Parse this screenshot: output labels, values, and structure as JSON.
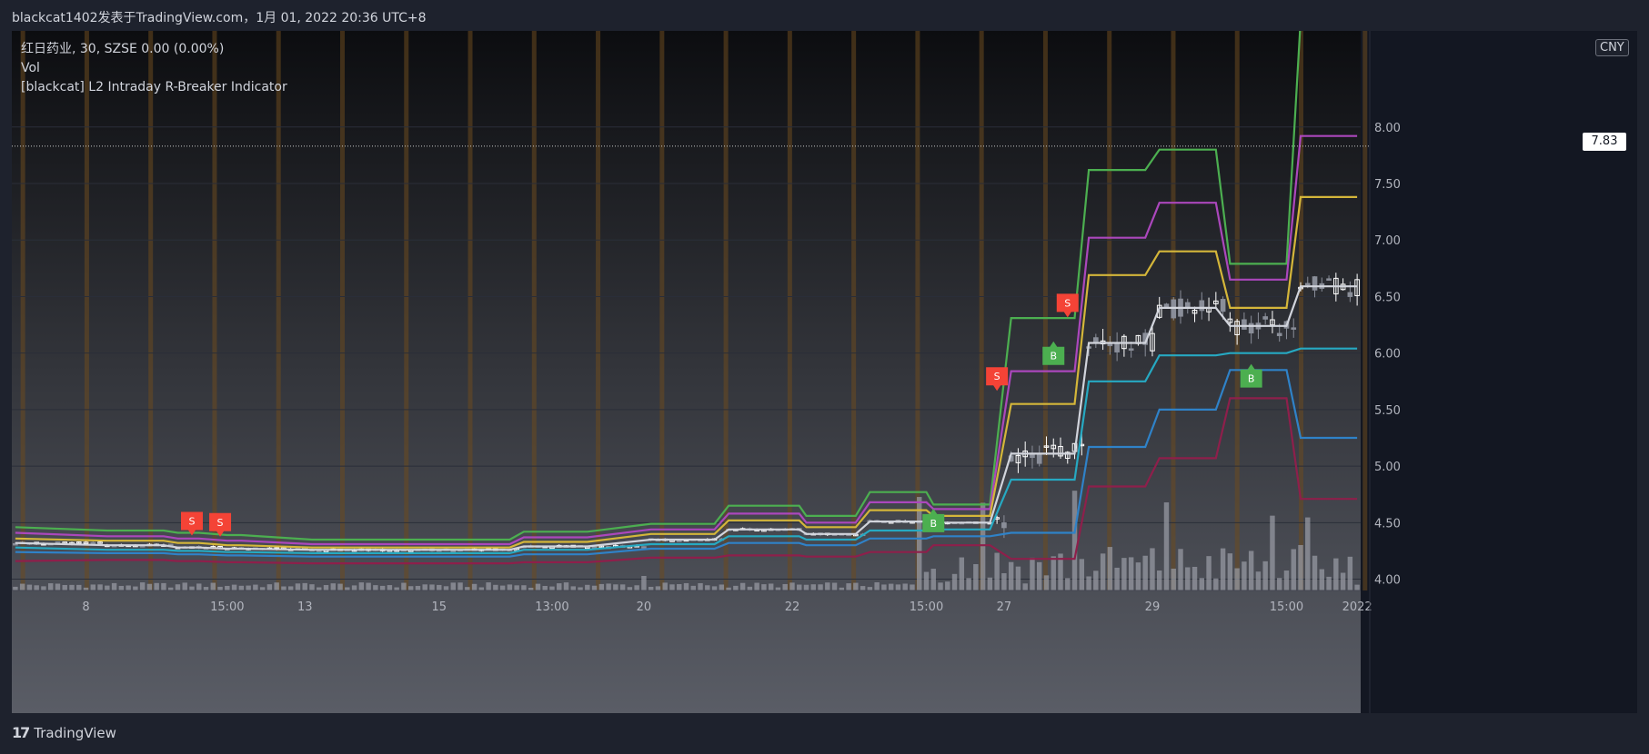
{
  "header": {
    "caption": "blackcat1402发表于TradingView.com，1月 01, 2022 20:36 UTC+8"
  },
  "legend": {
    "symbol": "红日药业, 30, SZSE  0.00 (0.00%)",
    "volume": "Vol",
    "indicator": "[blackcat] L2 Intraday R-Breaker Indicator"
  },
  "price_scale": {
    "currency": "CNY",
    "last_price": "7.83"
  },
  "footer": {
    "brand": "TradingView"
  },
  "colors": {
    "background": "#131722",
    "candle": "#ffffff",
    "candle_down": "#8a8e99",
    "volume": "#9598a1",
    "grid": "#2a2e39",
    "vline": "#6b4a1f",
    "buy_marker": "#4caf50",
    "sell_marker": "#f44336"
  },
  "chart_data": {
    "type": "line",
    "title": "",
    "xlabel": "",
    "ylabel": "",
    "ylim": [
      3.9,
      8.85
    ],
    "y_ticks": [
      "4.00",
      "4.50",
      "5.00",
      "5.50",
      "6.00",
      "6.50",
      "7.00",
      "7.50",
      "8.00"
    ],
    "x_tick_labels": [
      {
        "label": "8",
        "i": 10
      },
      {
        "label": "15:00",
        "i": 30
      },
      {
        "label": "13",
        "i": 41
      },
      {
        "label": "15",
        "i": 60
      },
      {
        "label": "13:00",
        "i": 76
      },
      {
        "label": "20",
        "i": 89
      },
      {
        "label": "22",
        "i": 110
      },
      {
        "label": "15:00",
        "i": 129
      },
      {
        "label": "27",
        "i": 140
      },
      {
        "label": "29",
        "i": 161
      },
      {
        "label": "15:00",
        "i": 180
      },
      {
        "label": "2022",
        "i": 190
      }
    ],
    "n_bars": 191,
    "series": [
      {
        "color": "#4caf50",
        "steps": [
          [
            0,
            4.46
          ],
          [
            13,
            4.43
          ],
          [
            21,
            4.43
          ],
          [
            23,
            4.41
          ],
          [
            26,
            4.41
          ],
          [
            30,
            4.39
          ],
          [
            32,
            4.39
          ],
          [
            42,
            4.35
          ],
          [
            70,
            4.35
          ],
          [
            72,
            4.42
          ],
          [
            81,
            4.42
          ],
          [
            90,
            4.49
          ],
          [
            99,
            4.49
          ],
          [
            101,
            4.65
          ],
          [
            111,
            4.65
          ],
          [
            112,
            4.56
          ],
          [
            119,
            4.56
          ],
          [
            121,
            4.77
          ],
          [
            129,
            4.77
          ],
          [
            130,
            4.66
          ],
          [
            138,
            4.66
          ],
          [
            141,
            6.31
          ],
          [
            150,
            6.31
          ],
          [
            152,
            7.62
          ],
          [
            160,
            7.62
          ],
          [
            162,
            7.8
          ],
          [
            170,
            7.8
          ],
          [
            172,
            6.79
          ],
          [
            180,
            6.79
          ],
          [
            182,
            8.95
          ]
        ]
      },
      {
        "color": "#ab47bc",
        "steps": [
          [
            0,
            4.41
          ],
          [
            13,
            4.38
          ],
          [
            21,
            4.38
          ],
          [
            23,
            4.36
          ],
          [
            26,
            4.36
          ],
          [
            30,
            4.34
          ],
          [
            32,
            4.34
          ],
          [
            42,
            4.31
          ],
          [
            70,
            4.31
          ],
          [
            72,
            4.37
          ],
          [
            81,
            4.37
          ],
          [
            90,
            4.44
          ],
          [
            99,
            4.44
          ],
          [
            101,
            4.58
          ],
          [
            111,
            4.58
          ],
          [
            112,
            4.5
          ],
          [
            119,
            4.5
          ],
          [
            121,
            4.68
          ],
          [
            129,
            4.68
          ],
          [
            130,
            4.62
          ],
          [
            138,
            4.62
          ],
          [
            141,
            5.84
          ],
          [
            150,
            5.84
          ],
          [
            152,
            7.02
          ],
          [
            160,
            7.02
          ],
          [
            162,
            7.33
          ],
          [
            170,
            7.33
          ],
          [
            172,
            6.65
          ],
          [
            180,
            6.65
          ],
          [
            182,
            7.92
          ]
        ]
      },
      {
        "color": "#d4b63a",
        "steps": [
          [
            0,
            4.36
          ],
          [
            13,
            4.34
          ],
          [
            21,
            4.34
          ],
          [
            23,
            4.32
          ],
          [
            26,
            4.32
          ],
          [
            30,
            4.3
          ],
          [
            32,
            4.3
          ],
          [
            42,
            4.28
          ],
          [
            70,
            4.28
          ],
          [
            72,
            4.33
          ],
          [
            81,
            4.33
          ],
          [
            90,
            4.4
          ],
          [
            99,
            4.4
          ],
          [
            101,
            4.52
          ],
          [
            111,
            4.52
          ],
          [
            112,
            4.46
          ],
          [
            119,
            4.46
          ],
          [
            121,
            4.61
          ],
          [
            129,
            4.61
          ],
          [
            130,
            4.56
          ],
          [
            138,
            4.56
          ],
          [
            141,
            5.55
          ],
          [
            150,
            5.55
          ],
          [
            152,
            6.69
          ],
          [
            160,
            6.69
          ],
          [
            162,
            6.9
          ],
          [
            170,
            6.9
          ],
          [
            172,
            6.4
          ],
          [
            180,
            6.4
          ],
          [
            182,
            7.38
          ]
        ]
      },
      {
        "color": "#d1d4dc",
        "steps": [
          [
            0,
            4.32
          ],
          [
            13,
            4.3
          ],
          [
            21,
            4.3
          ],
          [
            23,
            4.28
          ],
          [
            26,
            4.28
          ],
          [
            30,
            4.27
          ],
          [
            32,
            4.27
          ],
          [
            42,
            4.26
          ],
          [
            70,
            4.26
          ],
          [
            72,
            4.29
          ],
          [
            81,
            4.29
          ],
          [
            90,
            4.35
          ],
          [
            99,
            4.35
          ],
          [
            101,
            4.44
          ],
          [
            111,
            4.44
          ],
          [
            112,
            4.4
          ],
          [
            119,
            4.4
          ],
          [
            121,
            4.51
          ],
          [
            129,
            4.51
          ],
          [
            130,
            4.5
          ],
          [
            138,
            4.5
          ],
          [
            141,
            5.11
          ],
          [
            150,
            5.11
          ],
          [
            152,
            6.09
          ],
          [
            160,
            6.09
          ],
          [
            162,
            6.4
          ],
          [
            170,
            6.4
          ],
          [
            172,
            6.24
          ],
          [
            180,
            6.24
          ],
          [
            182,
            6.59
          ]
        ]
      },
      {
        "color": "#26a9c2",
        "steps": [
          [
            0,
            4.28
          ],
          [
            13,
            4.26
          ],
          [
            21,
            4.26
          ],
          [
            23,
            4.25
          ],
          [
            26,
            4.25
          ],
          [
            30,
            4.24
          ],
          [
            32,
            4.24
          ],
          [
            42,
            4.23
          ],
          [
            70,
            4.23
          ],
          [
            72,
            4.26
          ],
          [
            81,
            4.26
          ],
          [
            90,
            4.31
          ],
          [
            99,
            4.31
          ],
          [
            101,
            4.38
          ],
          [
            111,
            4.38
          ],
          [
            112,
            4.35
          ],
          [
            119,
            4.35
          ],
          [
            121,
            4.43
          ],
          [
            129,
            4.43
          ],
          [
            130,
            4.44
          ],
          [
            138,
            4.44
          ],
          [
            141,
            4.88
          ],
          [
            150,
            4.88
          ],
          [
            152,
            5.75
          ],
          [
            160,
            5.75
          ],
          [
            162,
            5.98
          ],
          [
            170,
            5.98
          ],
          [
            172,
            6.0
          ],
          [
            180,
            6.0
          ],
          [
            182,
            6.04
          ]
        ]
      },
      {
        "color": "#2f82c8",
        "steps": [
          [
            0,
            4.24
          ],
          [
            13,
            4.23
          ],
          [
            21,
            4.23
          ],
          [
            23,
            4.22
          ],
          [
            26,
            4.22
          ],
          [
            30,
            4.21
          ],
          [
            32,
            4.21
          ],
          [
            42,
            4.2
          ],
          [
            70,
            4.2
          ],
          [
            72,
            4.22
          ],
          [
            81,
            4.22
          ],
          [
            90,
            4.27
          ],
          [
            99,
            4.27
          ],
          [
            101,
            4.32
          ],
          [
            111,
            4.32
          ],
          [
            112,
            4.3
          ],
          [
            119,
            4.3
          ],
          [
            121,
            4.36
          ],
          [
            129,
            4.36
          ],
          [
            130,
            4.38
          ],
          [
            138,
            4.38
          ],
          [
            141,
            4.41
          ],
          [
            150,
            4.41
          ],
          [
            152,
            5.17
          ],
          [
            160,
            5.17
          ],
          [
            162,
            5.5
          ],
          [
            170,
            5.5
          ],
          [
            172,
            5.85
          ],
          [
            180,
            5.85
          ],
          [
            182,
            5.25
          ]
        ]
      },
      {
        "color": "#8e1f4b",
        "steps": [
          [
            0,
            4.16
          ],
          [
            13,
            4.17
          ],
          [
            21,
            4.17
          ],
          [
            23,
            4.16
          ],
          [
            26,
            4.16
          ],
          [
            30,
            4.15
          ],
          [
            32,
            4.15
          ],
          [
            42,
            4.14
          ],
          [
            70,
            4.14
          ],
          [
            72,
            4.15
          ],
          [
            81,
            4.15
          ],
          [
            90,
            4.19
          ],
          [
            99,
            4.19
          ],
          [
            101,
            4.21
          ],
          [
            111,
            4.21
          ],
          [
            112,
            4.2
          ],
          [
            119,
            4.2
          ],
          [
            121,
            4.24
          ],
          [
            129,
            4.24
          ],
          [
            130,
            4.3
          ],
          [
            138,
            4.3
          ],
          [
            141,
            4.18
          ],
          [
            150,
            4.18
          ],
          [
            152,
            4.82
          ],
          [
            160,
            4.82
          ],
          [
            162,
            5.07
          ],
          [
            170,
            5.07
          ],
          [
            172,
            5.6
          ],
          [
            180,
            5.6
          ],
          [
            182,
            4.71
          ]
        ]
      }
    ],
    "markers": [
      {
        "label": "S",
        "i": 25,
        "y": 4.37,
        "type": "sell"
      },
      {
        "label": "S",
        "i": 29,
        "y": 4.36,
        "type": "sell"
      },
      {
        "label": "B",
        "i": 130,
        "y": 4.64,
        "type": "buy"
      },
      {
        "label": "S",
        "i": 139,
        "y": 5.65,
        "type": "sell"
      },
      {
        "label": "B",
        "i": 147,
        "y": 6.12,
        "type": "buy"
      },
      {
        "label": "S",
        "i": 149,
        "y": 6.3,
        "type": "sell"
      },
      {
        "label": "B",
        "i": 175,
        "y": 5.92,
        "type": "buy"
      }
    ],
    "last_price": 7.83
  }
}
